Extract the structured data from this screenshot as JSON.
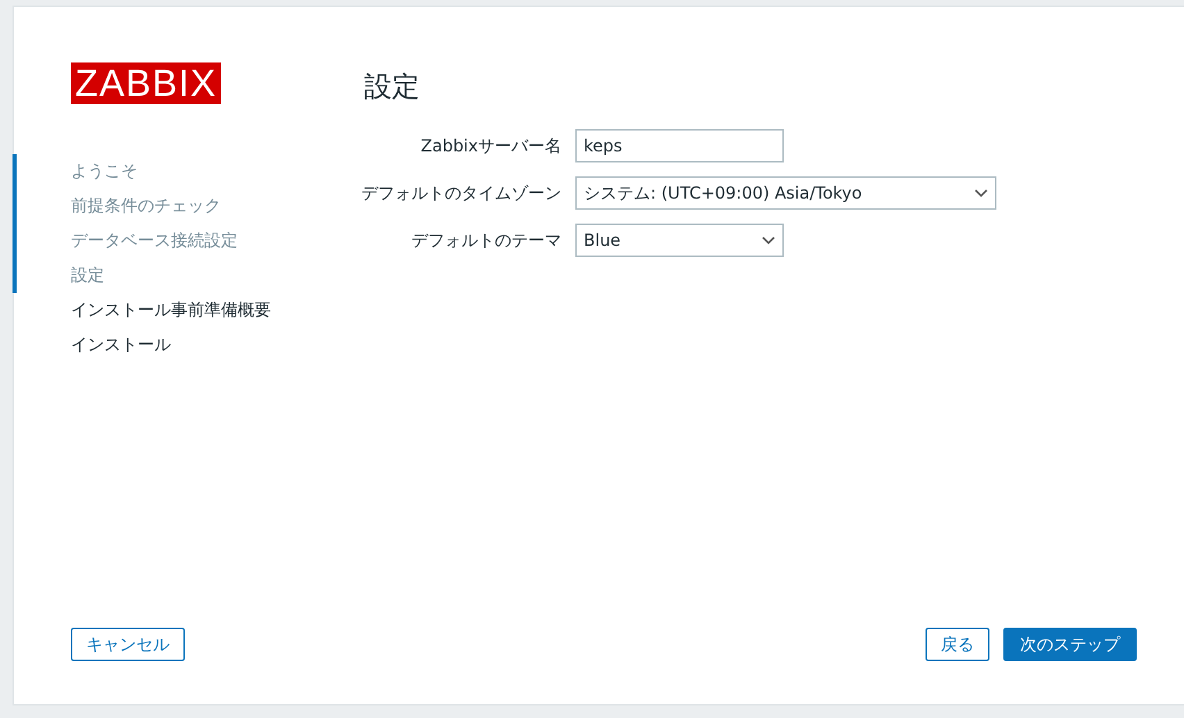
{
  "logo": "ZABBIX",
  "steps": [
    {
      "label": "ようこそ",
      "done": true
    },
    {
      "label": "前提条件のチェック",
      "done": true
    },
    {
      "label": "データベース接続設定",
      "done": true
    },
    {
      "label": "設定",
      "done": true
    },
    {
      "label": "インストール事前準備概要",
      "done": false
    },
    {
      "label": "インストール",
      "done": false
    }
  ],
  "heading": "設定",
  "fields": [
    {
      "kind": "text",
      "label": "Zabbixサーバー名",
      "value": "keps",
      "wide": false
    },
    {
      "kind": "select",
      "label": "デフォルトのタイムゾーン",
      "value": "システム: (UTC+09:00) Asia/Tokyo",
      "wide": true
    },
    {
      "kind": "select",
      "label": "デフォルトのテーマ",
      "value": "Blue",
      "wide": false
    }
  ],
  "buttons": {
    "cancel": "キャンセル",
    "back": "戻る",
    "next": "次のステップ"
  }
}
